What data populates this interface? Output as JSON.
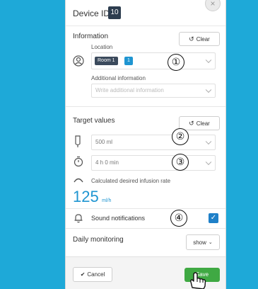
{
  "header": {
    "title": "Device ID",
    "device_id": "10",
    "close_icon": "close-icon"
  },
  "information": {
    "title": "Information",
    "clear_label": "Clear",
    "location_label": "Location",
    "room_tag": "Room 1",
    "room_count": "1",
    "additional_label": "Additional information",
    "additional_placeholder": "Write additional information"
  },
  "target": {
    "title": "Target values",
    "clear_label": "Clear",
    "volume": "500 ml",
    "duration": "4 h 0 min",
    "rate_label": "Calculated desired infusion rate",
    "rate_value": "125",
    "rate_unit": "ml/h"
  },
  "notifications": {
    "label": "Sound notifications",
    "checked": true,
    "check_glyph": "✓"
  },
  "daily": {
    "label": "Daily monitoring",
    "button": "show"
  },
  "footer": {
    "cancel_label": "Cancel",
    "save_label": "Save"
  },
  "annotations": {
    "one": "①",
    "two": "②",
    "three": "③",
    "four": "④"
  },
  "colors": {
    "accent": "#1f95d1",
    "save": "#3fa943",
    "background": "#1ea9d8"
  }
}
